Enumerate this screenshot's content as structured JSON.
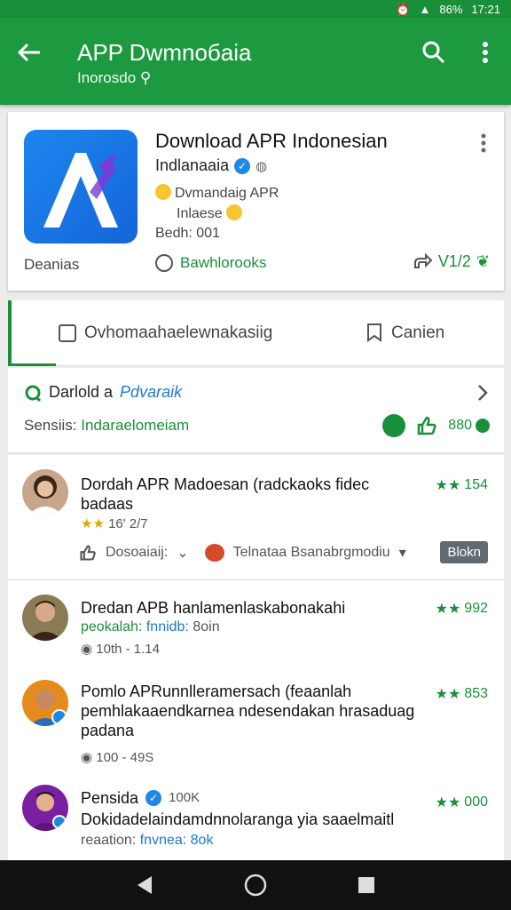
{
  "statusbar": {
    "time": "17:21",
    "battery": "86%"
  },
  "appbar": {
    "title": "APP Dwmnoбaia",
    "subtitle": "Inorosdo"
  },
  "app": {
    "name": "Download APR Indonesian",
    "developer": "Indlanaaia",
    "rating_line1": "Dvmandaig APR",
    "rating_line2": "Inlaese",
    "build": "Bedh: 001",
    "category": "Deanias",
    "feature": "Bawhlorooks",
    "share_count": "V1/2"
  },
  "tabs": [
    {
      "label": "Ovhomaahaelewnakasiig"
    },
    {
      "label": "Canien"
    }
  ],
  "section": {
    "title": "Darlold a",
    "title_link": "Pdvaraik",
    "sub_label": "Sensiis:",
    "sub_value": "Indaraelomeiam",
    "score": "880"
  },
  "reviews": [
    {
      "name": "Dordah APR Madoesan (radckaoks fidec badaas",
      "meta": "16'  2/7",
      "stars": "154",
      "action_left": "Dosoaiaij:",
      "action_right": "Telnataa Bsanabrgmodiu",
      "block_label": "Blokn"
    },
    {
      "name": "Dredan APB hanlamenlaskabonakahi",
      "line2_green": "peokalah:",
      "line2_blue": "fnnidb:",
      "line2_rest": "8oin",
      "meta": "10th - 1.14",
      "stars": "992"
    },
    {
      "name": "Pomlo APRunnlleramersach (feaanlah pemhlakaaendkarnea ndesendakan hrasaduag padana",
      "meta": "100 - 49S",
      "stars": "853"
    },
    {
      "name": "Pensida",
      "badge": "100K",
      "line2": "Dokidadelaindamdnnolaranga yia saaelmaitl",
      "line3_label": "reaation:",
      "line3_blue": "fnvnea: 8ok",
      "stars": "000"
    }
  ],
  "colors": {
    "primary": "#1d9a3f",
    "accent": "#1a8f3a",
    "link": "#1d7ac9"
  },
  "icons": [
    "back-arrow-icon",
    "search-icon",
    "more-vert-icon",
    "verified-icon",
    "globe-icon",
    "share-icon",
    "bookmark-icon",
    "chevron-right-icon",
    "thumbs-up-icon",
    "star-icon"
  ]
}
